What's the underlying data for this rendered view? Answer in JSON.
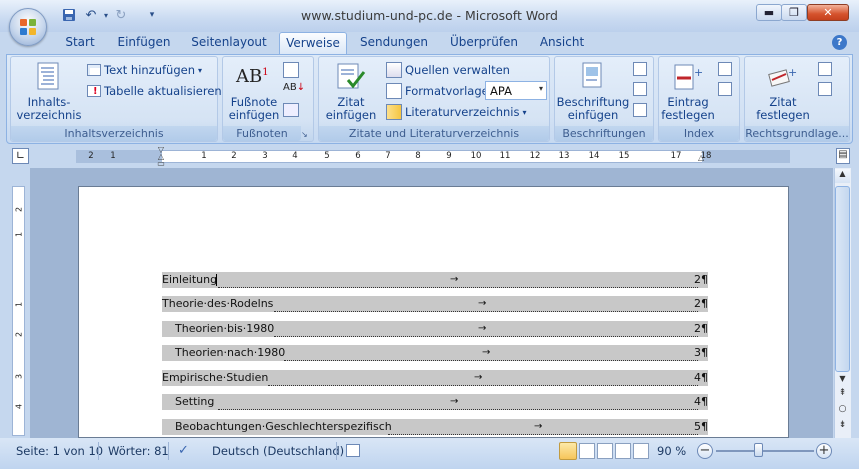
{
  "window": {
    "title": "www.studium-und-pc.de - Microsoft Word"
  },
  "tabs": [
    "Start",
    "Einfügen",
    "Seitenlayout",
    "Verweise",
    "Sendungen",
    "Überprüfen",
    "Ansicht"
  ],
  "active_tab": "Verweise",
  "ribbon": {
    "inhaltsverzeichnis": {
      "group_label": "Inhaltsverzeichnis",
      "main_button": "Inhalts-\nverzeichnis",
      "text_hinzufuegen": "Text hinzufügen",
      "tabelle_aktualisieren": "Tabelle aktualisieren"
    },
    "fussnoten": {
      "group_label": "Fußnoten",
      "main_button": "Fußnote\neinfügen"
    },
    "zitate": {
      "group_label": "Zitate und Literaturverzeichnis",
      "main_button": "Zitat\neinfügen",
      "quellen_verwalten": "Quellen verwalten",
      "formatvorlage_label": "Formatvorlage:",
      "formatvorlage_value": "APA",
      "literaturverzeichnis": "Literaturverzeichnis"
    },
    "beschriftungen": {
      "group_label": "Beschriftungen",
      "main_button": "Beschriftung\neinfügen"
    },
    "index": {
      "group_label": "Index",
      "main_button": "Eintrag\nfestlegen"
    },
    "rechtsgrundlagen": {
      "group_label": "Rechtsgrundlage...",
      "main_button": "Zitat\nfestlegen"
    }
  },
  "ruler": {
    "ticks": [
      "2",
      "1",
      "1",
      "2",
      "3",
      "4",
      "5",
      "6",
      "7",
      "8",
      "9",
      "10",
      "11",
      "12",
      "13",
      "14",
      "15",
      "17",
      "18"
    ]
  },
  "vruler": {
    "ticks": [
      "2",
      "1",
      "1",
      "2",
      "3",
      "4"
    ]
  },
  "document": {
    "toc": [
      {
        "text": "Einleitung",
        "page": "2¶",
        "level": 1
      },
      {
        "text": "Theorie·des·Rodelns",
        "page": "2¶",
        "level": 1
      },
      {
        "text": "Theorien·bis·1980",
        "page": "2¶",
        "level": 2
      },
      {
        "text": "Theorien·nach·1980",
        "page": "3¶",
        "level": 2
      },
      {
        "text": "Empirische·Studien",
        "page": "4¶",
        "level": 1
      },
      {
        "text": "Setting",
        "page": "4¶",
        "level": 2
      },
      {
        "text": "Beobachtungen·Geschlechterspezifisch",
        "page": "5¶",
        "level": 2
      }
    ]
  },
  "status": {
    "page": "Seite: 1 von 10",
    "words": "Wörter: 81",
    "language": "Deutsch (Deutschland)",
    "zoom": "90 %"
  }
}
